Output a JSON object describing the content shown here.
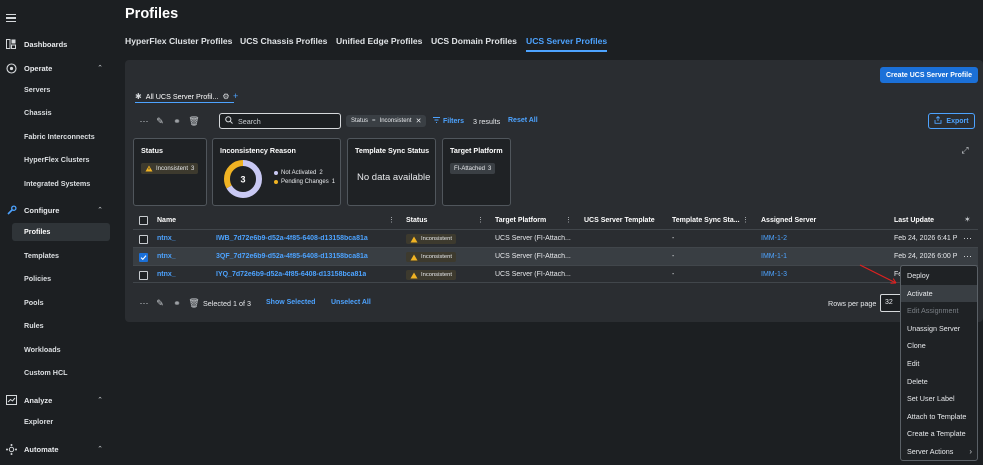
{
  "page": {
    "title": "Profiles"
  },
  "sidebar": {
    "sections": [
      {
        "label": "Dashboards",
        "icon": "dashboard-icon"
      },
      {
        "label": "Operate",
        "icon": "operate-icon"
      },
      {
        "label": "Configure",
        "icon": "configure-icon"
      },
      {
        "label": "Analyze",
        "icon": "analyze-icon"
      },
      {
        "label": "Automate",
        "icon": "automate-icon"
      }
    ],
    "operate_items": [
      "Servers",
      "Chassis",
      "Fabric Interconnects",
      "HyperFlex Clusters",
      "Integrated Systems"
    ],
    "configure_items": [
      "Profiles",
      "Templates",
      "Policies",
      "Pools",
      "Rules",
      "Workloads",
      "Custom HCL"
    ],
    "analyze_items": [
      "Explorer"
    ],
    "active_item": "Profiles"
  },
  "tabs": [
    "HyperFlex Cluster Profiles",
    "UCS Chassis Profiles",
    "Unified Edge Profiles",
    "UCS Domain Profiles",
    "UCS Server Profiles"
  ],
  "active_tab": "UCS Server Profiles",
  "toolbar": {
    "create_label": "Create UCS Server Profile",
    "view_tab": "All UCS Server Profil...",
    "search_placeholder": "Search",
    "filter_chip": {
      "key": "Status",
      "op": "=",
      "value": "Inconsistent"
    },
    "filters_label": "Filters",
    "results": "3 results",
    "reset_label": "Reset All",
    "export_label": "Export"
  },
  "cards": {
    "status": {
      "title": "Status",
      "badge": "Inconsistent",
      "count": "3"
    },
    "inconsistency": {
      "title": "Inconsistency Reason",
      "total": "3",
      "legend": [
        {
          "label": "Not Activated",
          "value": "2",
          "color": "#c9c9f4"
        },
        {
          "label": "Pending Changes",
          "value": "1",
          "color": "#f0b323"
        }
      ]
    },
    "template_sync": {
      "title": "Template Sync Status",
      "empty": "No data available"
    },
    "target_platform": {
      "title": "Target Platform",
      "badge": "FI-Attached",
      "count": "3"
    }
  },
  "table": {
    "headers": [
      "Name",
      "Status",
      "Target Platform",
      "UCS Server Template",
      "Template Sync Sta...",
      "Assigned Server",
      "Last Update"
    ],
    "rows": [
      {
        "name_prefix": "ntnx_",
        "name_suffix": "IWB_7d72e6b9-d52a-4f85-6408-d13158bca81a",
        "status": "Inconsistent",
        "platform": "UCS Server (FI-Attach...",
        "template": "",
        "sync": "-",
        "server": "IMM-1-2",
        "updated": "Feb 24, 2026 6:41 P",
        "selected": false
      },
      {
        "name_prefix": "ntnx_",
        "name_suffix": "3QF_7d72e6b9-d52a-4f85-6408-d13158bca81a",
        "status": "Inconsistent",
        "platform": "UCS Server (FI-Attach...",
        "template": "",
        "sync": "-",
        "server": "IMM-1-1",
        "updated": "Feb 24, 2026 6:00 P",
        "selected": true
      },
      {
        "name_prefix": "ntnx_",
        "name_suffix": "IYQ_7d72e6b9-d52a-4f85-6408-d13158bca81a",
        "status": "Inconsistent",
        "platform": "UCS Server (FI-Attach...",
        "template": "",
        "sync": "-",
        "server": "IMM-1-3",
        "updated": "Fe",
        "selected": false
      }
    ]
  },
  "footer": {
    "selected_text": "Selected 1 of 3",
    "show_selected": "Show Selected",
    "unselect_all": "Unselect All",
    "rows_per_page_label": "Rows per page",
    "rows_per_page_value": "32"
  },
  "menu": {
    "items": [
      {
        "label": "Deploy",
        "state": "normal"
      },
      {
        "label": "Activate",
        "state": "hover"
      },
      {
        "label": "Edit Assignment",
        "state": "disabled"
      },
      {
        "label": "Unassign Server",
        "state": "normal"
      },
      {
        "label": "Clone",
        "state": "normal"
      },
      {
        "label": "Edit",
        "state": "normal"
      },
      {
        "label": "Delete",
        "state": "normal"
      },
      {
        "label": "Set User Label",
        "state": "normal"
      },
      {
        "label": "Attach to Template",
        "state": "normal"
      },
      {
        "label": "Create a Template",
        "state": "normal"
      },
      {
        "label": "Server Actions",
        "state": "submenu"
      }
    ]
  },
  "colors": {
    "accent": "#4da3ff",
    "primary": "#1b70d8",
    "warning": "#f0b323",
    "bg": "#1c1f22",
    "panel": "#2a2d31"
  }
}
